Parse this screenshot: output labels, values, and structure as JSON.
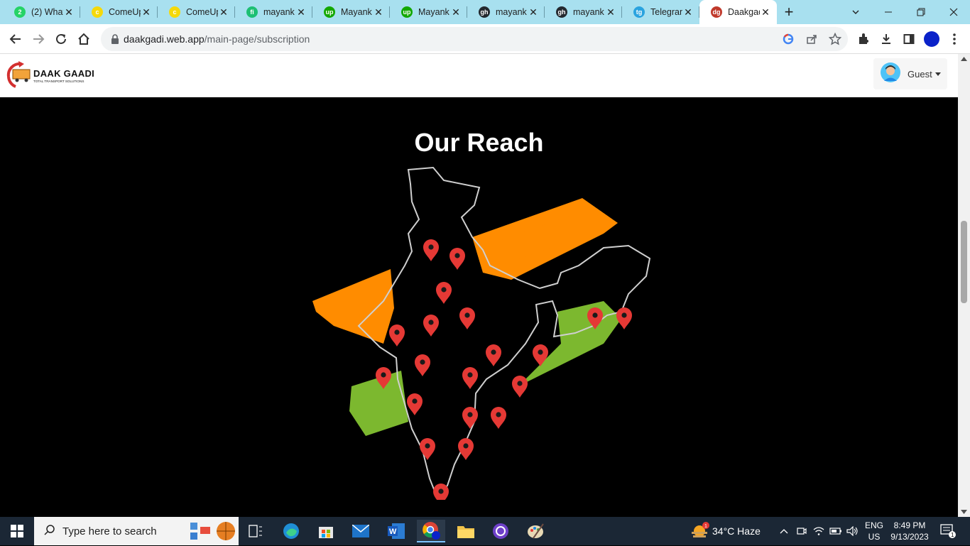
{
  "browser": {
    "tabs": [
      {
        "title": "(2) What",
        "favicon_color": "#25d366",
        "favicon_glyph": "2"
      },
      {
        "title": "ComeUp",
        "favicon_color": "#f5d90a",
        "favicon_glyph": "c"
      },
      {
        "title": "ComeUp",
        "favicon_color": "#f5d90a",
        "favicon_glyph": "c"
      },
      {
        "title": "mayank",
        "favicon_color": "#1dbf73",
        "favicon_glyph": "fi"
      },
      {
        "title": "Mayank",
        "favicon_color": "#14a800",
        "favicon_glyph": "up"
      },
      {
        "title": "Mayank",
        "favicon_color": "#14a800",
        "favicon_glyph": "up"
      },
      {
        "title": "mayank",
        "favicon_color": "#24292f",
        "favicon_glyph": "gh"
      },
      {
        "title": "mayank",
        "favicon_color": "#24292f",
        "favicon_glyph": "gh"
      },
      {
        "title": "Telegran",
        "favicon_color": "#2aa3df",
        "favicon_glyph": "tg"
      },
      {
        "title": "Daakgad",
        "favicon_color": "#c0392b",
        "favicon_glyph": "dg"
      }
    ],
    "close_glyph": "✕",
    "newtab_glyph": "+",
    "url_host": "daakgadi.web.app",
    "url_path": "/main-page/subscription"
  },
  "site": {
    "logo_text": "DAAK GAADI",
    "logo_tagline": "TOTAL TRANSPORT SOLUTIONS",
    "guest_label": "Guest",
    "reach_title": "Our Reach"
  },
  "taskbar": {
    "search_placeholder": "Type here to search",
    "weather": "34°C  Haze",
    "lang_top": "ENG",
    "lang_bottom": "US",
    "time": "8:49 PM",
    "date": "9/13/2023",
    "notification_count": "1",
    "weather_badge": "1"
  },
  "colors": {
    "pin": "#e53935",
    "saffron": "#ff8c00",
    "green": "#7cb82f",
    "tabstrip": "#a8e0ef"
  }
}
